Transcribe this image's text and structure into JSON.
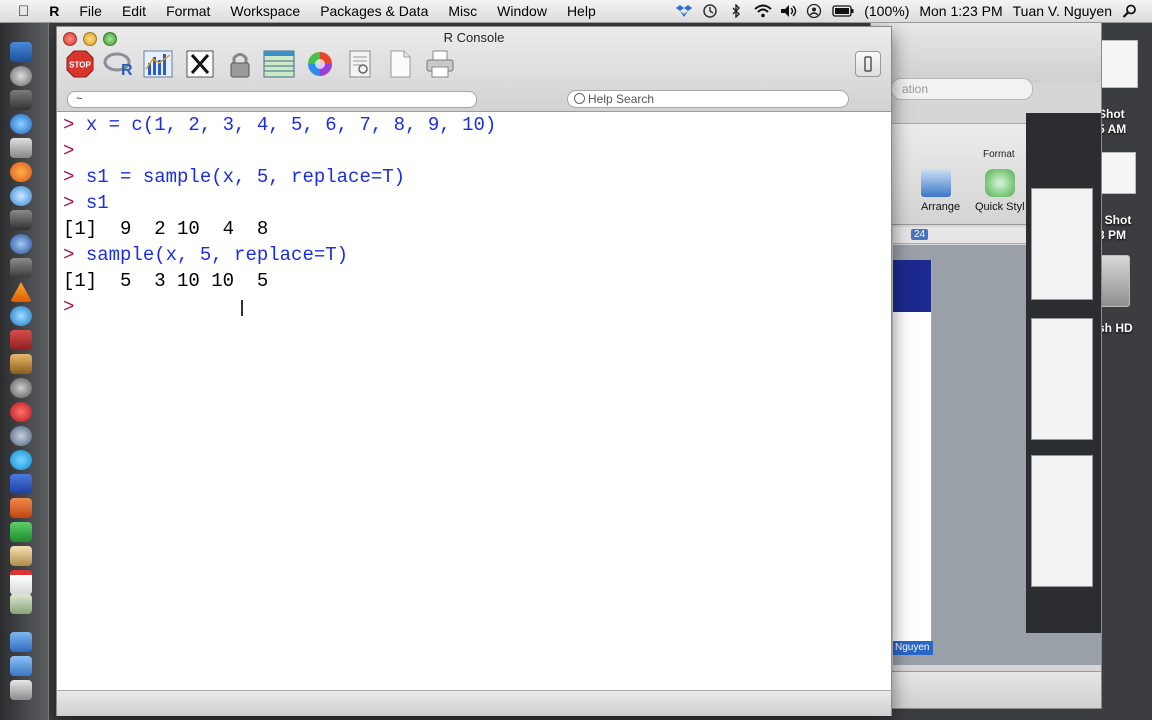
{
  "menubar": {
    "items": [
      "R",
      "File",
      "Edit",
      "Format",
      "Workspace",
      "Packages & Data",
      "Misc",
      "Window",
      "Help"
    ],
    "battery": "(100%)",
    "clock": "Mon 1:23 PM",
    "user": "Tuan V. Nguyen",
    "icons": [
      "apple-icon",
      "dropbox-icon",
      "time-machine-icon",
      "bluetooth-icon",
      "wifi-icon",
      "volume-icon",
      "user-icon",
      "battery-icon",
      "spotlight-icon"
    ]
  },
  "window": {
    "title": "R Console",
    "toolbar_icons": [
      "stop-icon",
      "r-logo-icon",
      "chart-icon",
      "x11-icon",
      "lock-icon",
      "table-icon",
      "color-wheel-icon",
      "document-icon",
      "blank-page-icon",
      "print-icon"
    ],
    "path_value": "~",
    "help_placeholder": "Help Search"
  },
  "console": {
    "lines": [
      {
        "prompt": ">",
        "text": "x = c(1, 2, 3, 4, 5, 6, 7, 8, 9, 10)",
        "kind": "cmd"
      },
      {
        "prompt": ">",
        "text": "",
        "kind": "cmd"
      },
      {
        "prompt": ">",
        "text": "s1 = sample(x, 5, replace=T)",
        "kind": "cmd"
      },
      {
        "prompt": ">",
        "text": "s1",
        "kind": "cmd"
      },
      {
        "prompt": "",
        "text": "[1]  9  2 10  4  8",
        "kind": "out"
      },
      {
        "prompt": ">",
        "text": "sample(x, 5, replace=T)",
        "kind": "cmd"
      },
      {
        "prompt": "",
        "text": "[1]  5  3 10 10  5",
        "kind": "out"
      },
      {
        "prompt": ">",
        "text": "",
        "kind": "cmd"
      }
    ]
  },
  "background_window": {
    "field_text": "ation",
    "format_label": "Format",
    "arrange_label": "Arrange",
    "quick_style_label": "Quick Styl",
    "ruler_number": "24",
    "name_tag": "Nguyen"
  },
  "desktop": {
    "labels": [
      "Shot",
      "5 AM",
      "n Shot",
      "3 PM",
      "sh HD"
    ]
  },
  "colors": {
    "prompt": "#a0145a",
    "command": "#1a2fe0",
    "output": "#000000"
  }
}
